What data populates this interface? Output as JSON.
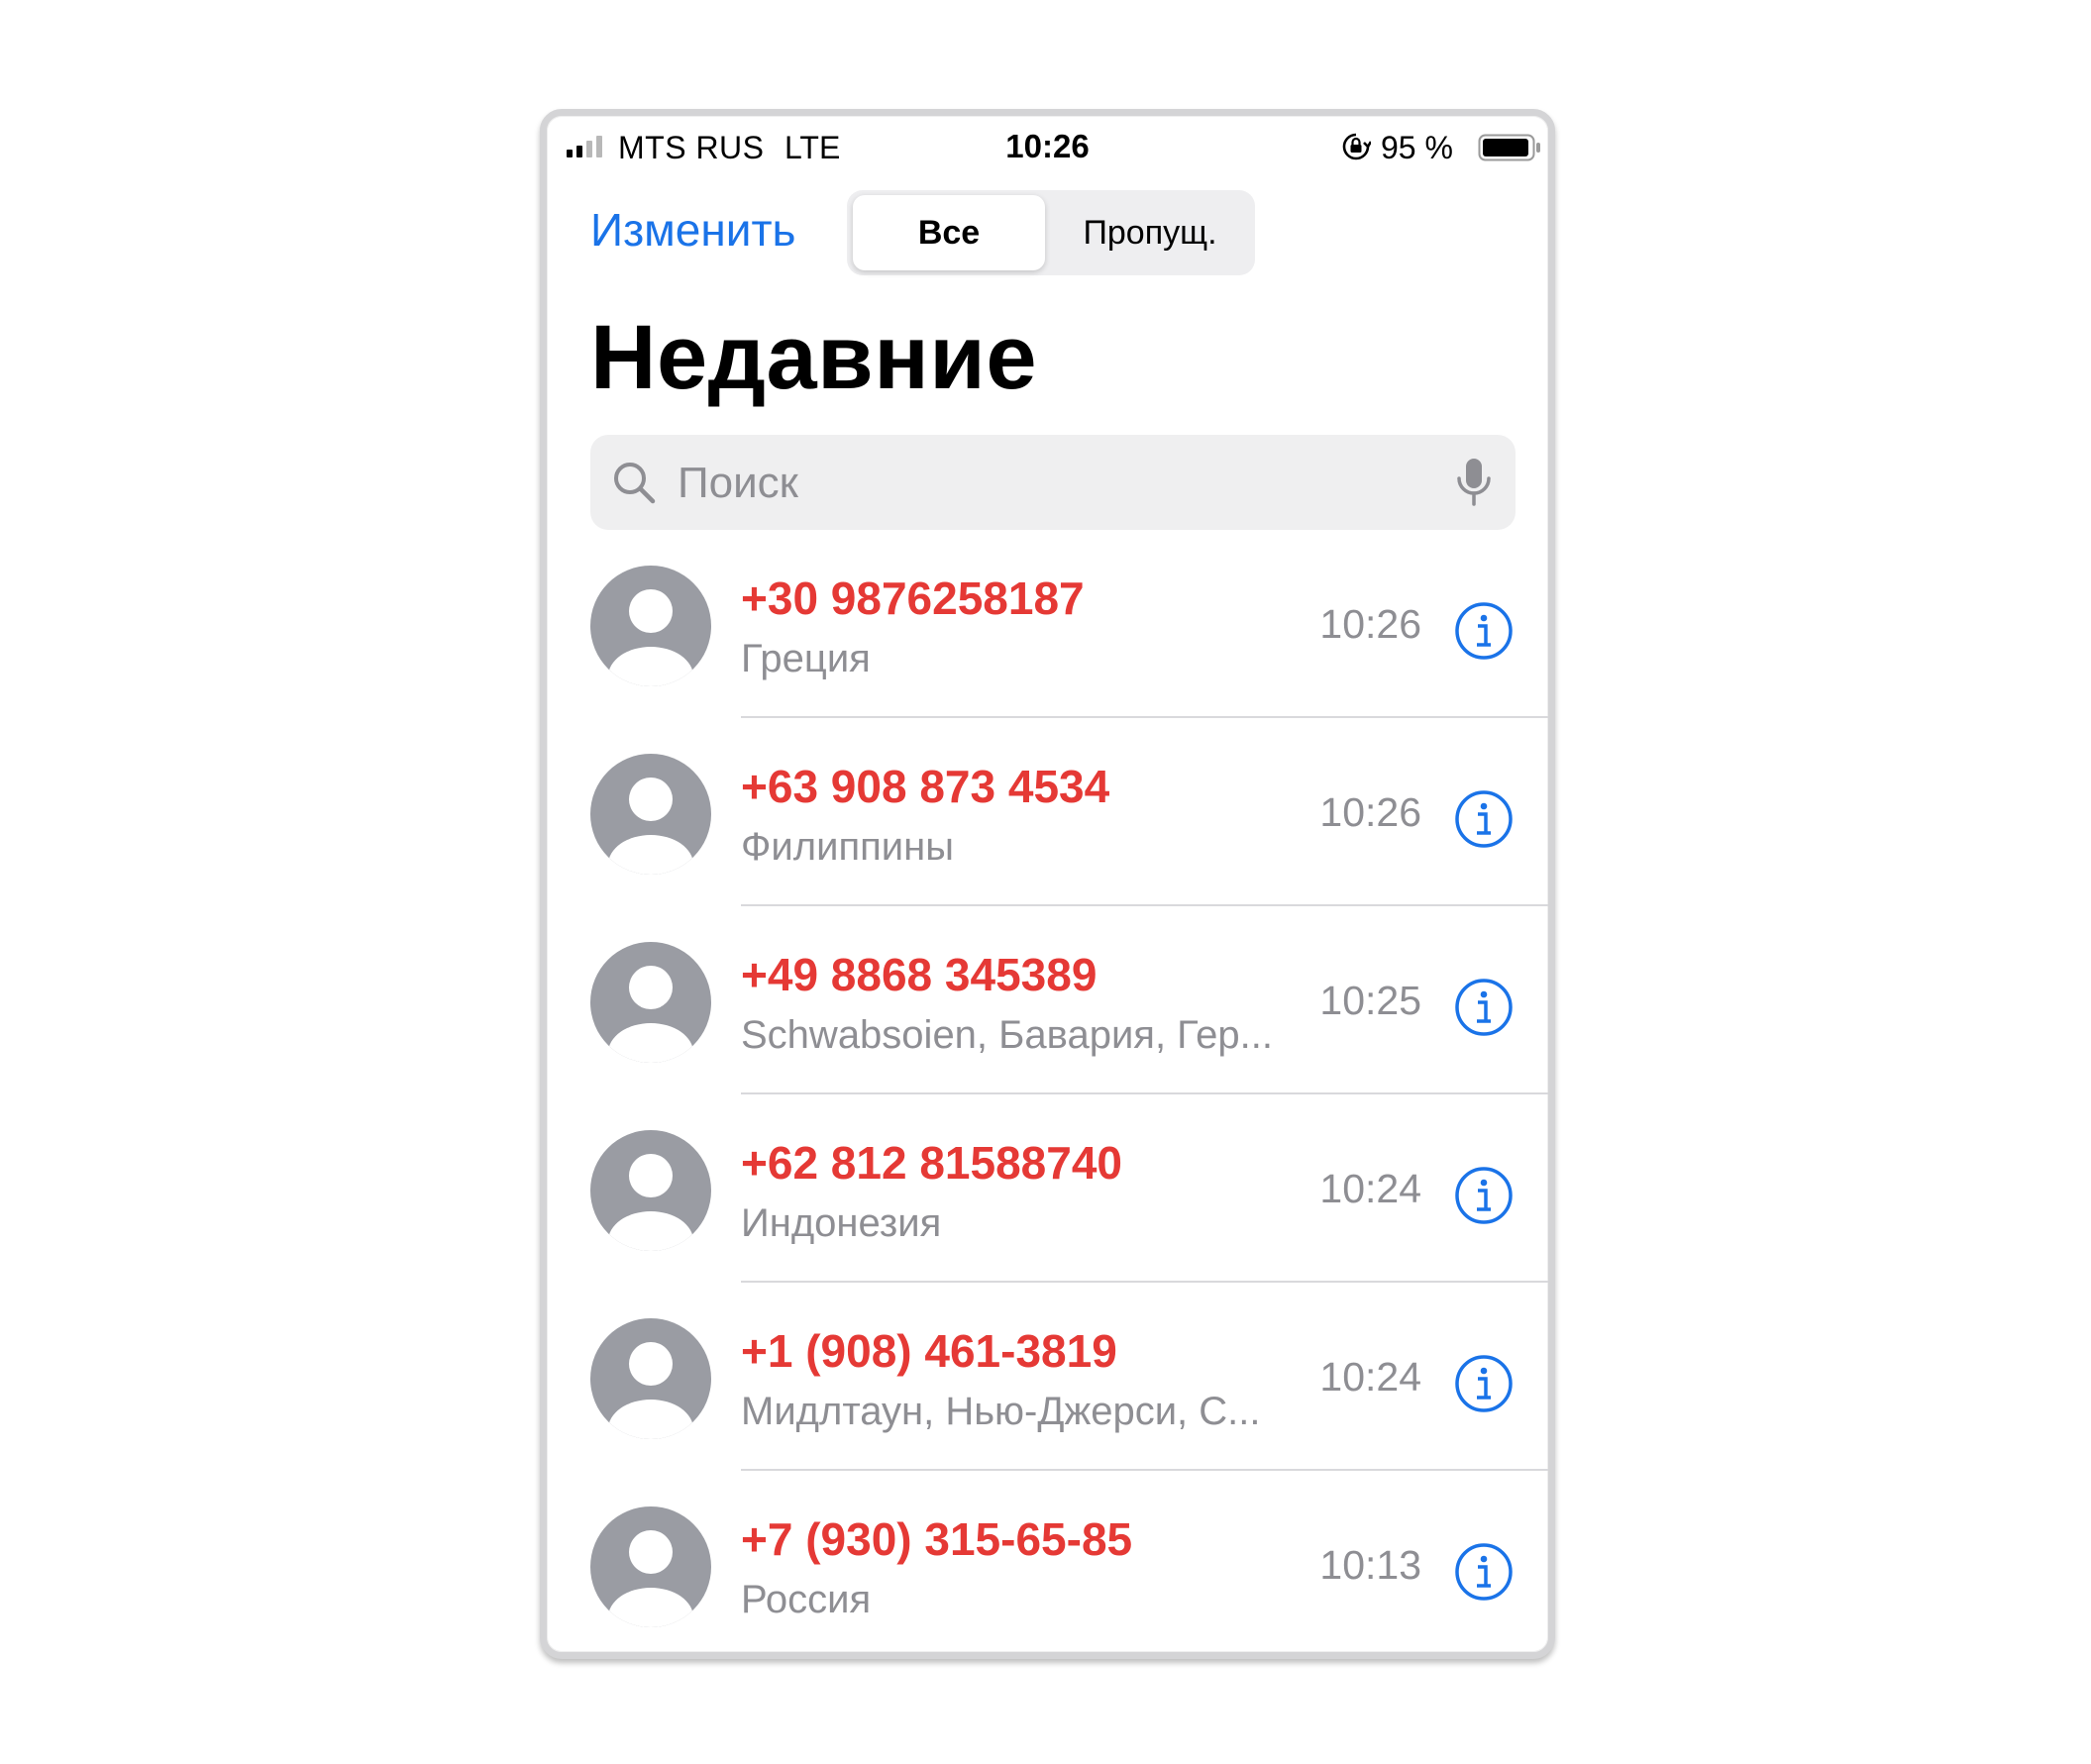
{
  "status_bar": {
    "carrier": "MTS RUS",
    "network": "LTE",
    "time": "10:26",
    "battery_percent": "95 %",
    "icons": [
      "signal-icon",
      "orientation-lock-icon",
      "battery-icon"
    ]
  },
  "nav": {
    "edit_label": "Изменить",
    "segments": {
      "all": "Все",
      "missed": "Пропущ."
    },
    "selected_segment": "all"
  },
  "page_title": "Недавние",
  "search": {
    "placeholder": "Поиск",
    "value": ""
  },
  "calls": [
    {
      "number": "+30 9876258187",
      "location": "Греция",
      "time": "10:26"
    },
    {
      "number": "+63 908 873 4534",
      "location": "Филиппины",
      "time": "10:26"
    },
    {
      "number": "+49 8868 345389",
      "location": "Schwabsoien, Бавария, Гер...",
      "time": "10:25"
    },
    {
      "number": "+62 812 81588740",
      "location": "Индонезия",
      "time": "10:24"
    },
    {
      "number": "+1 (908) 461-3819",
      "location": "Мидлтаун, Нью-Джерси, С...",
      "time": "10:24"
    },
    {
      "number": "+7 (930) 315-65-85",
      "location": "Россия",
      "time": "10:13"
    }
  ],
  "colors": {
    "accent": "#1a73e8",
    "missed_call": "#e53935",
    "secondary_text": "#8e8e93",
    "avatar": "#9a9ca3"
  }
}
